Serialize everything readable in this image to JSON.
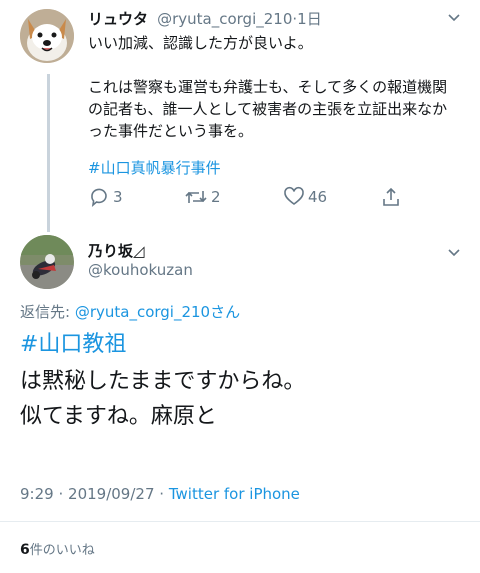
{
  "reply_tweet": {
    "name": "リュウタ",
    "handle": "@ryuta_corgi_210",
    "separator": "·",
    "time": "1日",
    "text_line1": "いい加減、認識した方が良いよ。",
    "text_para2": "これは警察も運営も弁護士も、そして多くの報道機関の記者も、誰一人として被害者の主張を立証出来なかった事件だという事を。",
    "hashtag": "#山口真帆暴行事件",
    "reply_count": "3",
    "retweet_count": "2",
    "like_count": "46"
  },
  "main_tweet": {
    "name": "乃り坂◿",
    "handle": "@kouhokuzan",
    "reply_to_label": "返信先: ",
    "reply_to_handle": "@ryuta_corgi_210",
    "reply_to_suffix": "さん",
    "hashtag": "#山口教祖",
    "text_line1": "は黙秘したままですからね。",
    "text_line2": "似てますね。麻原と",
    "time": "9:29",
    "dot": "·",
    "date": "2019/09/27",
    "source": "Twitter for iPhone"
  },
  "likes": {
    "count": "6",
    "label": "件のいいね"
  },
  "colors": {
    "link": "#1b95e0",
    "muted": "#657786",
    "text": "#14171a"
  }
}
